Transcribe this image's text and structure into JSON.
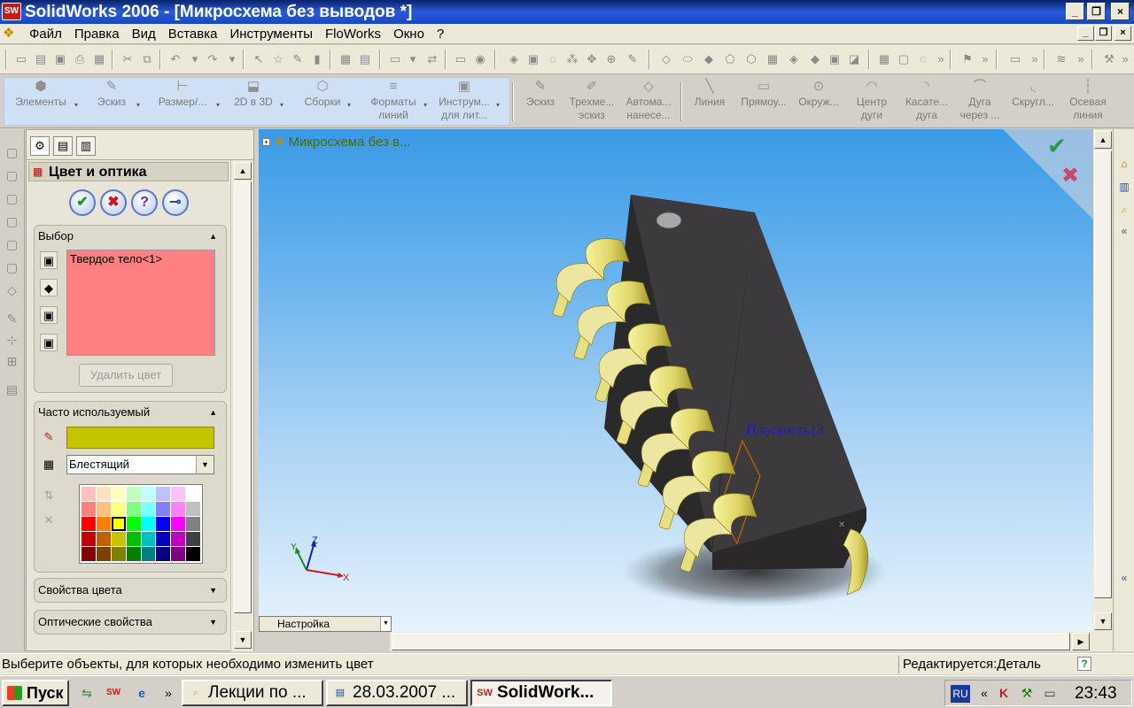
{
  "window": {
    "title": "SolidWorks 2006 - [Микросхема без выводов *]",
    "app_icon": "solidworks-logo-icon",
    "app_icon_text": "SW",
    "controls": [
      "_",
      "❐",
      "×"
    ]
  },
  "menu": {
    "items": [
      "Файл",
      "Правка",
      "Вид",
      "Вставка",
      "Инструменты",
      "FloWorks",
      "Окно",
      "?"
    ],
    "mdi_controls": [
      "_",
      "❐",
      "×"
    ]
  },
  "command_manager": {
    "left_buttons": [
      {
        "label": "Элементы",
        "icon": "features-icon"
      },
      {
        "label": "Эскиз",
        "icon": "sketch-icon"
      },
      {
        "label": "Размер/...",
        "icon": "dimension-icon"
      },
      {
        "label": "2D в 3D",
        "icon": "2d-to-3d-icon"
      },
      {
        "label": "Сборки",
        "icon": "assembly-icon"
      },
      {
        "label": "Форматы линий",
        "icon": "line-format-icon"
      },
      {
        "label": "Инструм... для лит...",
        "icon": "mold-tools-icon"
      }
    ],
    "right_buttons": [
      {
        "label": "Эскиз",
        "icon": "sketch-icon"
      },
      {
        "label": "Трехме... эскиз",
        "icon": "3d-sketch-icon"
      },
      {
        "label": "Автома... нанесе...",
        "icon": "autodimension-icon"
      },
      {
        "label": "Линия",
        "icon": "line-icon"
      },
      {
        "label": "Прямоу...",
        "icon": "rectangle-icon"
      },
      {
        "label": "Окруж...",
        "icon": "circle-icon"
      },
      {
        "label": "Центр дуги",
        "icon": "centerpoint-arc-icon"
      },
      {
        "label": "Касате... дуга",
        "icon": "tangent-arc-icon"
      },
      {
        "label": "Дуга через ...",
        "icon": "3point-arc-icon"
      },
      {
        "label": "Скругл...",
        "icon": "fillet-icon"
      },
      {
        "label": "Осевая линия",
        "icon": "centerline-icon"
      }
    ]
  },
  "property_manager": {
    "title": "Цвет и оптика",
    "action_buttons": [
      {
        "name": "ok",
        "glyph": "✔",
        "color": "#1a9a1a"
      },
      {
        "name": "cancel",
        "glyph": "✖",
        "color": "#c81a1a"
      },
      {
        "name": "help",
        "glyph": "?",
        "color": "#6a2aa8"
      },
      {
        "name": "pin",
        "glyph": "⊸",
        "color": "#2a4aa8"
      }
    ],
    "selection": {
      "title": "Выбор",
      "items": [
        "Твердое тело<1>"
      ],
      "list_color": "#ff8080",
      "remove_color_label": "Удалить цвет"
    },
    "favorite": {
      "title": "Часто используемый",
      "current_color": "#c4c400",
      "finish_value": "Блестящий",
      "palette": [
        "#ffc0c0",
        "#ffe0c0",
        "#ffffc0",
        "#c0ffc0",
        "#c0ffff",
        "#c0c0ff",
        "#ffc0ff",
        "#ffffff",
        "#ff8080",
        "#ffc080",
        "#ffff80",
        "#80ff80",
        "#80ffff",
        "#8080ff",
        "#ff80ff",
        "#c0c0c0",
        "#ff0000",
        "#ff8000",
        "#ffff00",
        "#00ff00",
        "#00ffff",
        "#0000ff",
        "#ff00ff",
        "#808080",
        "#c00000",
        "#c06000",
        "#c4c400",
        "#00c000",
        "#00c0c0",
        "#0000c0",
        "#c000c0",
        "#404040",
        "#800000",
        "#804000",
        "#808000",
        "#008000",
        "#008080",
        "#000080",
        "#800080",
        "#000000"
      ],
      "selected_index": 18
    },
    "color_properties_label": "Свойства цвета",
    "optical_properties_label": "Оптические свойства"
  },
  "viewport": {
    "tree_root_label": "Микросхема без в...",
    "plane_label": "Плоскость13",
    "view_combo_value": "Настройка",
    "triad_axes": [
      "X",
      "Y",
      "Z"
    ],
    "confirm_ok": "✔",
    "confirm_cancel": "✖"
  },
  "status": {
    "text": "Выберите объекты, для которых необходимо изменить цвет",
    "mode": "Редактируется:Деталь",
    "help": "?"
  },
  "taskbar": {
    "start_label": "Пуск",
    "tasks": [
      {
        "label": "Лекции по ...",
        "icon": "folder-search-icon",
        "active": false
      },
      {
        "label": "28.03.2007 ...",
        "icon": "word-doc-icon",
        "active": false
      },
      {
        "label": "SolidWork...",
        "icon": "solidworks-logo-icon",
        "active": true
      }
    ],
    "tray_lang": "RU",
    "clock": "23:43"
  }
}
